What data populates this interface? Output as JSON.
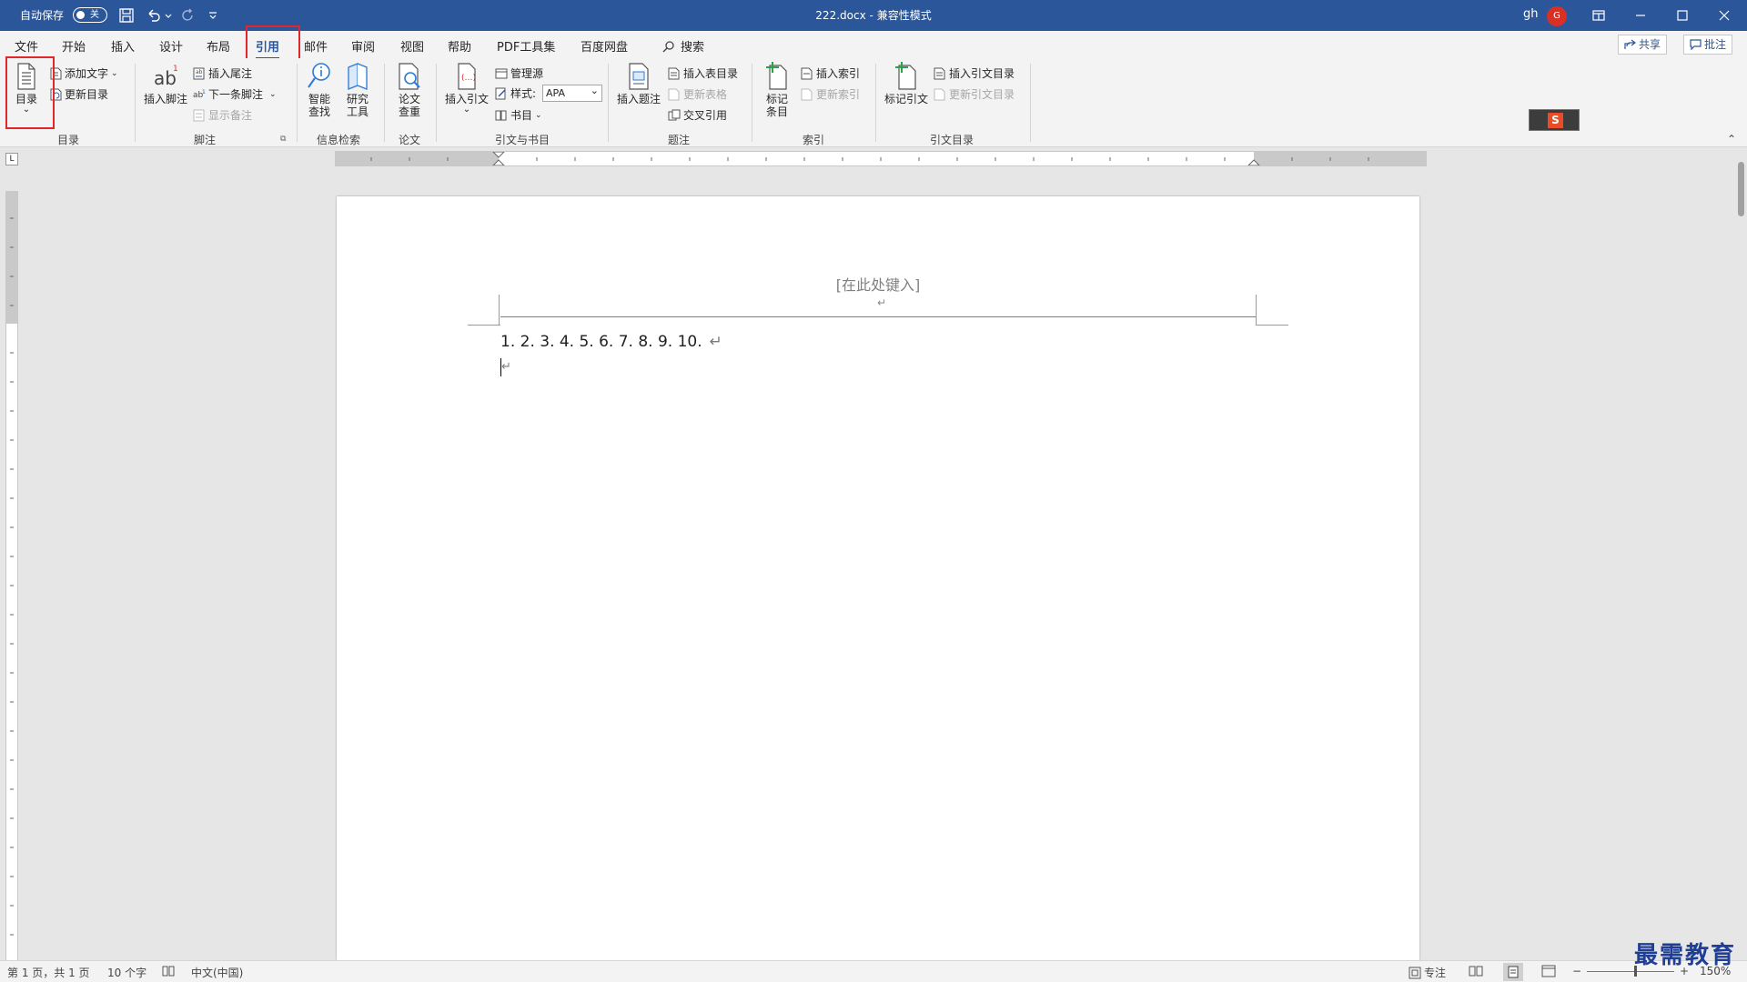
{
  "titlebar": {
    "autosave_label": "自动保存",
    "autosave_state": "关",
    "document_title": "222.docx",
    "separator": "-",
    "mode": "兼容性模式",
    "user_name": "gh",
    "user_initial": "G",
    "accent_color": "#2b579a"
  },
  "tabs": [
    "文件",
    "开始",
    "插入",
    "设计",
    "布局",
    "引用",
    "邮件",
    "审阅",
    "视图",
    "帮助",
    "PDF工具集",
    "百度网盘"
  ],
  "active_tab": "引用",
  "search_label": "搜索",
  "share_label": "共享",
  "comments_label": "批注",
  "ribbon": {
    "toc_group": {
      "toc_button": "目录",
      "add_text": "添加文字",
      "update_toc": "更新目录",
      "label": "目录"
    },
    "footnote_group": {
      "insert_footnote": "插入脚注",
      "insert_endnote": "插入尾注",
      "next_footnote": "下一条脚注",
      "show_notes": "显示备注",
      "label": "脚注"
    },
    "research_group": {
      "smart_lookup_1": "智能",
      "smart_lookup_2": "查找",
      "research_1": "研究",
      "research_2": "工具",
      "label": "信息检索"
    },
    "paper_group": {
      "check_1": "论文",
      "check_2": "查重",
      "label": "论文"
    },
    "citation_group": {
      "insert_citation": "插入引文",
      "manage_sources": "管理源",
      "style_label": "样式:",
      "style_value": "APA",
      "bibliography": "书目",
      "label": "引文与书目"
    },
    "caption_group": {
      "insert_caption": "插入题注",
      "insert_table_of_figures": "插入表目录",
      "update_table": "更新表格",
      "cross_reference": "交叉引用",
      "label": "题注"
    },
    "index_group": {
      "mark_entry_1": "标记",
      "mark_entry_2": "条目",
      "insert_index": "插入索引",
      "update_index": "更新索引",
      "label": "索引"
    },
    "authorities_group": {
      "mark_citation": "标记引文",
      "insert_table_of_authorities": "插入引文目录",
      "update_table_of_authorities": "更新引文目录",
      "label": "引文目录"
    }
  },
  "document": {
    "header_placeholder": "[在此处键入]",
    "paragraph_mark": "↵",
    "body_line": "1. 2. 3. 4. 5. 6. 7. 8. 9. 10."
  },
  "statusbar": {
    "page_info": "第 1 页，共 1 页",
    "word_count": "10 个字",
    "language": "中文(中国)",
    "focus": "专注",
    "zoom_minus": "−",
    "zoom_plus": "+",
    "zoom": "150%"
  },
  "watermark": "最需教育"
}
